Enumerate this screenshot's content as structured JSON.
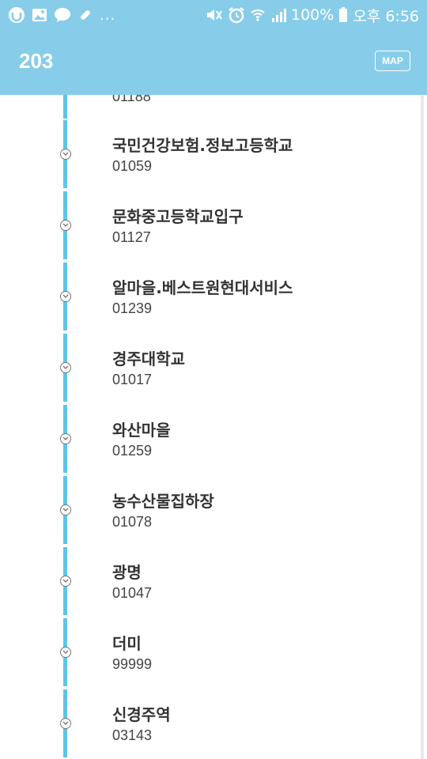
{
  "status_bar": {
    "left_icons": [
      "cloud-app-icon",
      "image-icon",
      "talk-icon",
      "pill-icon"
    ],
    "more": "...",
    "battery_text": "100%",
    "time": "오후 6:56",
    "right_icons": [
      "mute-icon",
      "alarm-icon",
      "wifi-icon",
      "signal-icon",
      "battery-icon"
    ]
  },
  "header": {
    "title": "203",
    "map_button": "MAP"
  },
  "colors": {
    "header_bg": "#87cdea",
    "route_line": "#5ec4e8"
  },
  "stops": [
    {
      "name": "",
      "id": "01188"
    },
    {
      "name": "국민건강보험.정보고등학교",
      "id": "01059"
    },
    {
      "name": "문화중고등학교입구",
      "id": "01127"
    },
    {
      "name": "알마을.베스트원현대서비스",
      "id": "01239"
    },
    {
      "name": "경주대학교",
      "id": "01017"
    },
    {
      "name": "와산마을",
      "id": "01259"
    },
    {
      "name": "농수산물집하장",
      "id": "01078"
    },
    {
      "name": "광명",
      "id": "01047"
    },
    {
      "name": "더미",
      "id": "99999"
    },
    {
      "name": "신경주역",
      "id": "03143"
    }
  ]
}
